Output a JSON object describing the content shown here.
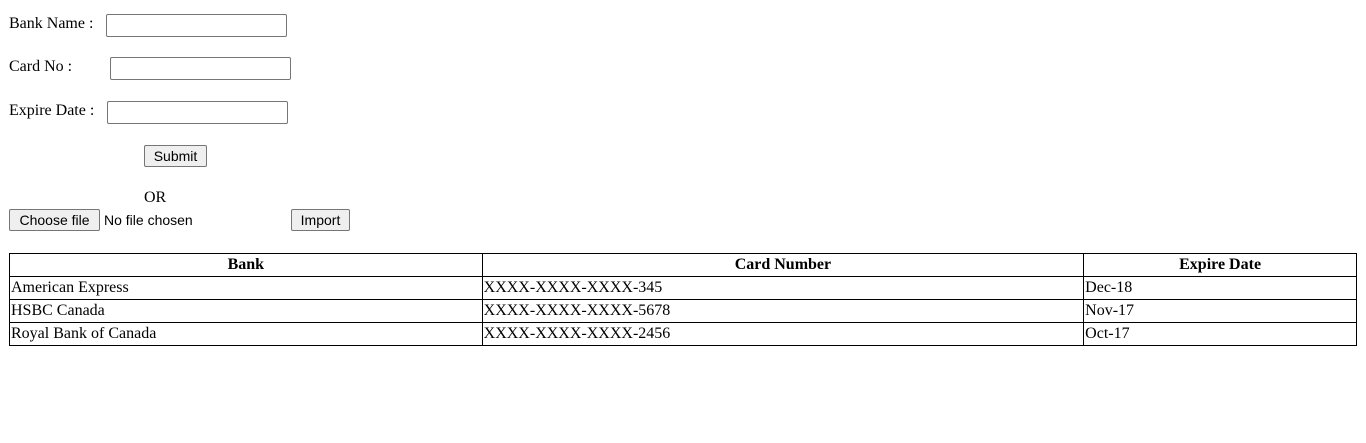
{
  "form": {
    "bank_name_label": "Bank Name :",
    "bank_name_value": "",
    "card_no_label": "Card No :",
    "card_no_value": "",
    "expire_date_label": "Expire Date :",
    "expire_date_value": "",
    "submit_label": "Submit",
    "or_label": "OR"
  },
  "file_import": {
    "choose_file_label": "Choose file",
    "file_status": "No file chosen",
    "import_label": "Import"
  },
  "table": {
    "headers": [
      "Bank",
      "Card Number",
      "Expire Date"
    ],
    "rows": [
      [
        "American Express",
        "XXXX-XXXX-XXXX-345",
        "Dec-18"
      ],
      [
        "HSBC Canada",
        "XXXX-XXXX-XXXX-5678",
        "Nov-17"
      ],
      [
        "Royal Bank of Canada",
        "XXXX-XXXX-XXXX-2456",
        "Oct-17"
      ]
    ]
  }
}
